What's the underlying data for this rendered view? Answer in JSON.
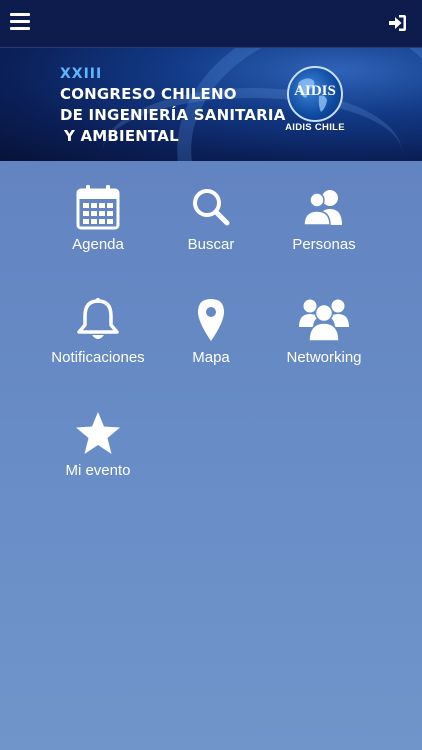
{
  "header": {
    "menu_icon": "hamburger-menu-icon",
    "login_icon": "sign-in-icon"
  },
  "banner": {
    "edition": "XXIII",
    "line1": "CONGRESO CHILENO",
    "line2": "DE INGENIERÍA SANITARIA",
    "line3": "Y AMBIENTAL",
    "logo_text": "AIDIS",
    "logo_sub": "AIDIS CHILE"
  },
  "menu": {
    "items": [
      {
        "label": "Agenda",
        "icon": "calendar-icon"
      },
      {
        "label": "Buscar",
        "icon": "search-icon"
      },
      {
        "label": "Personas",
        "icon": "people-icon"
      },
      {
        "label": "Notificaciones",
        "icon": "bell-icon"
      },
      {
        "label": "Mapa",
        "icon": "map-pin-icon"
      },
      {
        "label": "Networking",
        "icon": "group-icon"
      },
      {
        "label": "Mi evento",
        "icon": "star-icon"
      }
    ]
  },
  "colors": {
    "topbar": "#0d1b4d",
    "background": "#6689c4",
    "text": "#ffffff",
    "accent": "#5fb6ff"
  }
}
